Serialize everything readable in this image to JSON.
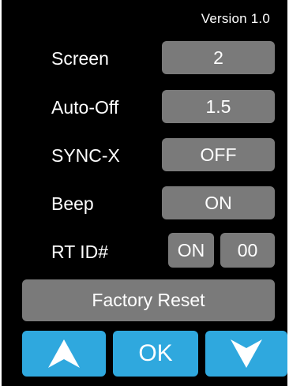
{
  "header": {
    "version_text": "Version 1.0"
  },
  "settings": {
    "screen": {
      "label": "Screen",
      "value": "2"
    },
    "auto_off": {
      "label": "Auto-Off",
      "value": "1.5"
    },
    "sync_x": {
      "label": "SYNC-X",
      "value": "OFF"
    },
    "beep": {
      "label": "Beep",
      "value": "ON"
    },
    "rt_id": {
      "label": "RT ID#",
      "state": "ON",
      "id": "00"
    }
  },
  "actions": {
    "factory_reset_label": "Factory Reset",
    "up_icon": "arrow-up-icon",
    "ok_label": "OK",
    "down_icon": "arrow-down-icon"
  },
  "colors": {
    "background": "#000000",
    "value_button": "#7a7a7a",
    "nav_button": "#2fa8de",
    "text": "#ffffff"
  }
}
